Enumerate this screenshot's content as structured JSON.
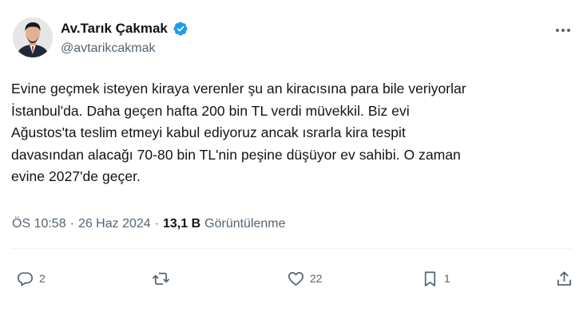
{
  "author": {
    "display_name": "Av.Tarık Çakmak",
    "handle": "@avtarikcakmak",
    "verified": true,
    "verified_color": "#1d9bf0"
  },
  "tweet": {
    "text": "Evine geçmek isteyen kiraya verenler şu an kiracısına para bile veriyorlar\nİstanbul'da. Daha geçen hafta 200 bin TL verdi müvekkil. Biz evi\nAğustos'ta teslim etmeyi kabul ediyoruz ancak ısrarla kira tespit\ndavasından alacağı 70-80 bin TL'nin peşine düşüyor ev sahibi. O zaman\nevine 2027'de geçer."
  },
  "meta": {
    "time": "ÖS 10:58",
    "separator1": "·",
    "date": "26 Haz 2024",
    "separator2": "·",
    "views_count": "13,1 B",
    "views_label": "Görüntülenme"
  },
  "actions": {
    "reply": {
      "icon": "reply-icon",
      "count": "2"
    },
    "retweet": {
      "icon": "retweet-icon",
      "count": ""
    },
    "like": {
      "icon": "heart-icon",
      "count": "22"
    },
    "bookmark": {
      "icon": "bookmark-icon",
      "count": "1"
    },
    "share": {
      "icon": "share-icon",
      "count": ""
    }
  },
  "colors": {
    "text_primary": "#0f1419",
    "text_secondary": "#536471",
    "divider": "#eff3f4"
  }
}
